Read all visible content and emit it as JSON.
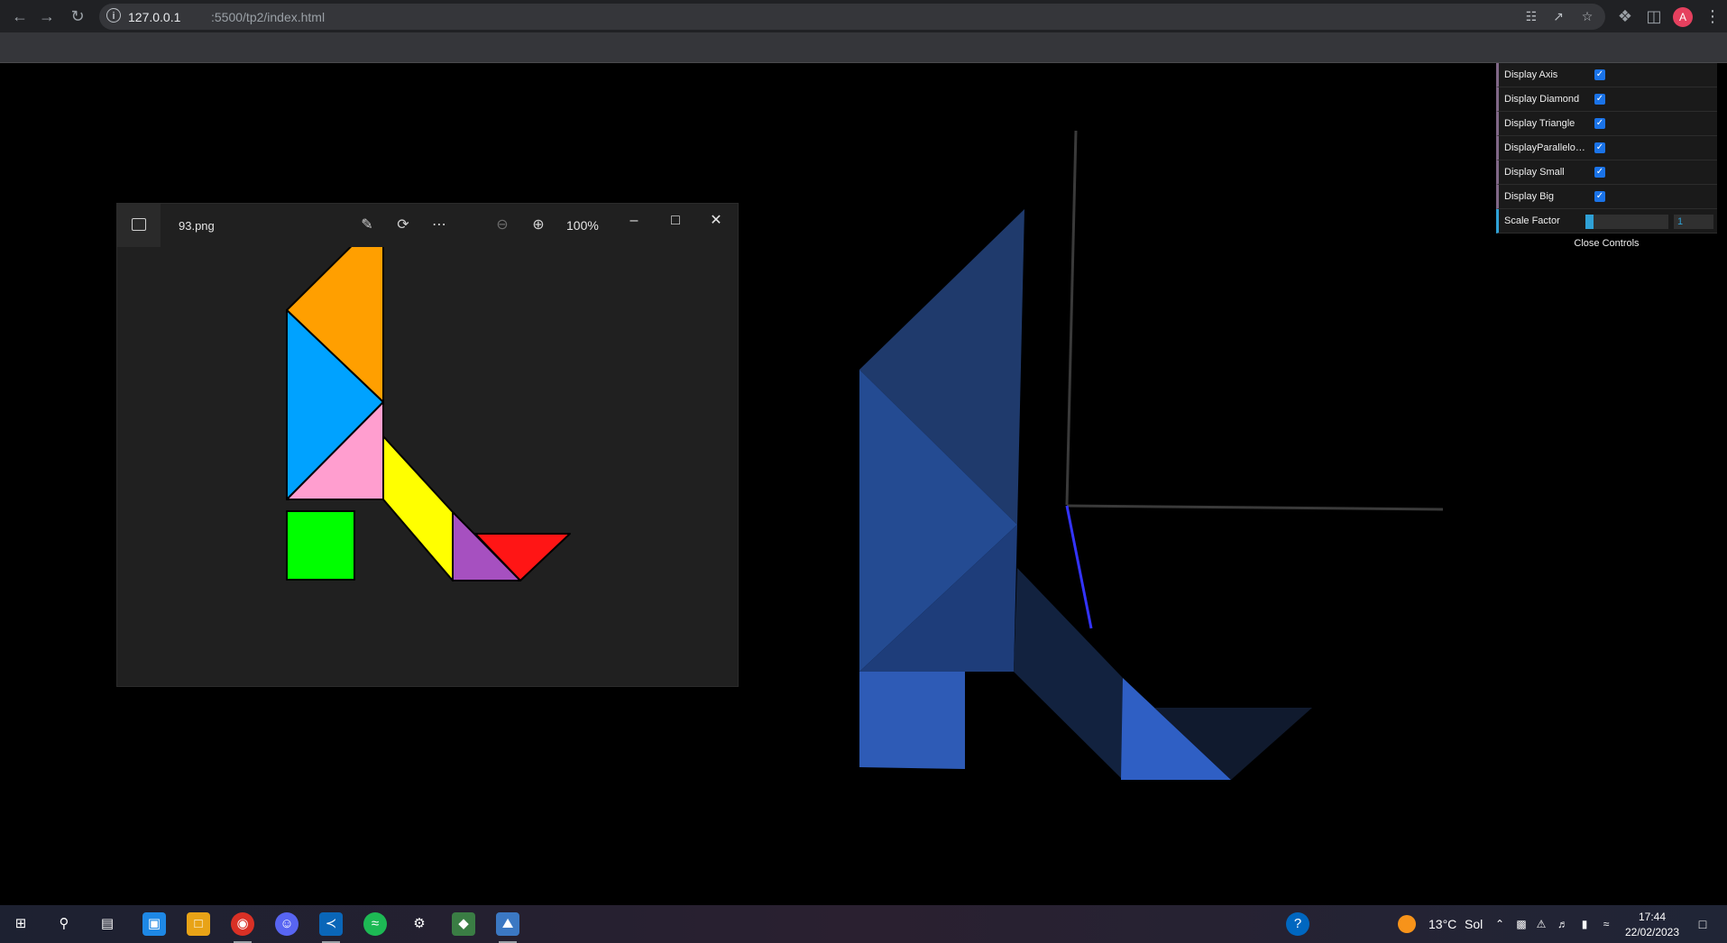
{
  "browser": {
    "url_host": "127.0.0.1",
    "url_path": ":5500/tp2/index.html",
    "avatar_letter": "A",
    "icons": [
      "back-icon",
      "forward-icon",
      "reload-icon",
      "info-icon",
      "translate-icon",
      "share-icon",
      "star-icon",
      "extensions-icon",
      "sidepanel-icon",
      "menu-icon"
    ]
  },
  "viewer": {
    "filename": "93.png",
    "zoom": "100%",
    "tangram_colors": {
      "big_triangle_top": "#ff9f00",
      "big_triangle_left": "#00a2ff",
      "small_triangle": "#ff9ecf",
      "parallelogram": "#ffff00",
      "medium_triangle": "#a650c0",
      "diamond": "#00ff00",
      "red_triangle": "#ff1515"
    }
  },
  "gui": {
    "controls": [
      {
        "label": "Display Axis",
        "checked": true
      },
      {
        "label": "Display Diamond",
        "checked": true
      },
      {
        "label": "Display Triangle",
        "checked": true
      },
      {
        "label": "DisplayParallelogram",
        "checked": true
      },
      {
        "label": "Display Small",
        "checked": true
      },
      {
        "label": "Display Big",
        "checked": true
      }
    ],
    "scale_label": "Scale Factor",
    "scale_value": "1",
    "scale_fraction": 0.1,
    "close_label": "Close Controls"
  },
  "taskbar": {
    "weather": "13°C",
    "weather_desc": "Sol",
    "time": "17:44",
    "date": "22/02/2023"
  }
}
